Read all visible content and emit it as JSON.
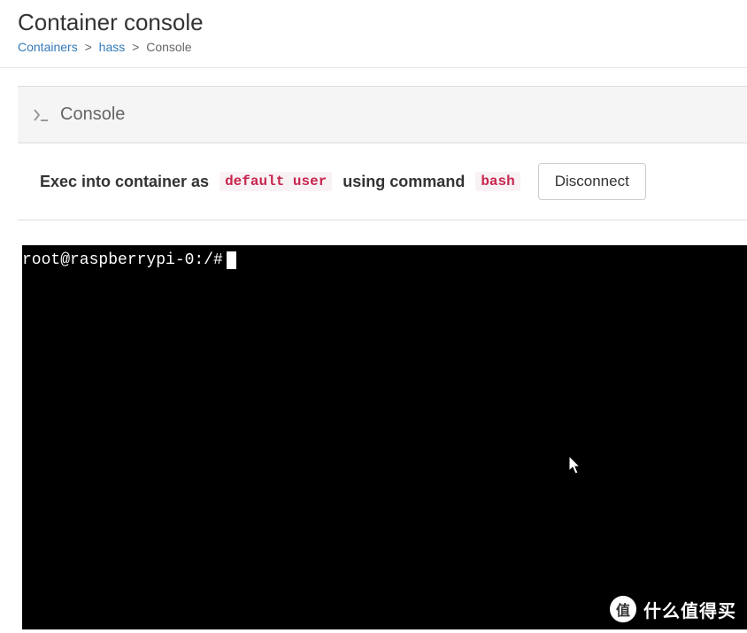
{
  "header": {
    "title": "Container console"
  },
  "breadcrumb": {
    "items": [
      {
        "label": "Containers",
        "link": true
      },
      {
        "label": "hass",
        "link": true
      },
      {
        "label": "Console",
        "link": false
      }
    ],
    "separator": ">"
  },
  "panel": {
    "title": "Console"
  },
  "exec": {
    "prefix": "Exec into container as",
    "user": "default user",
    "middle": "using command",
    "command": "bash",
    "disconnect_label": "Disconnect"
  },
  "terminal": {
    "prompt": "root@raspberrypi-0:/#"
  },
  "watermark": {
    "icon_char": "值",
    "text": "什么值得买"
  }
}
